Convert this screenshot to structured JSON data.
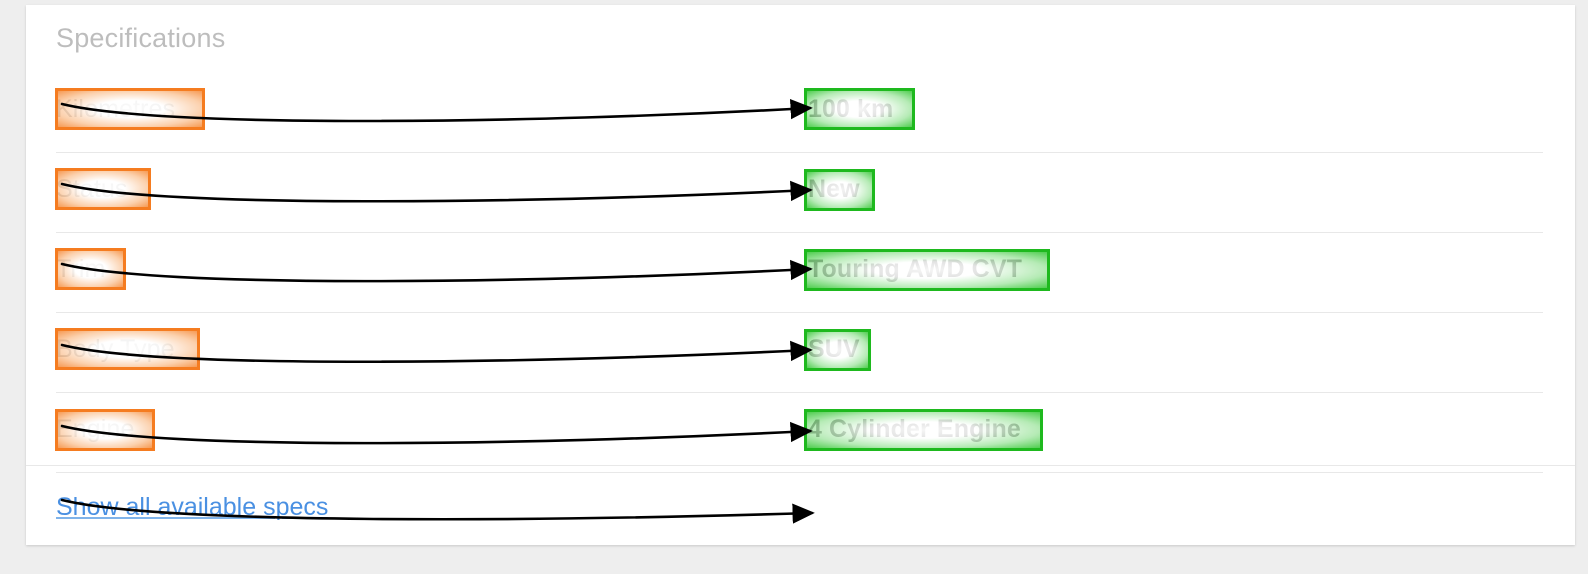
{
  "card": {
    "title": "Specifications"
  },
  "specs": [
    {
      "label": "Kilometres",
      "value": "100 km"
    },
    {
      "label": "Status",
      "value": "New"
    },
    {
      "label": "Trim",
      "value": "Touring AWD CVT"
    },
    {
      "label": "Body Type",
      "value": "SUV"
    },
    {
      "label": "Engine",
      "value": "4 Cylinder Engine"
    }
  ],
  "footer": {
    "show_all_label": "Show all available specs"
  },
  "annotations": {
    "label_highlight_color": "#f57c20",
    "value_highlight_color": "#1eb91e",
    "arrow_color": "#000000",
    "link_color": "#4a90e2"
  }
}
